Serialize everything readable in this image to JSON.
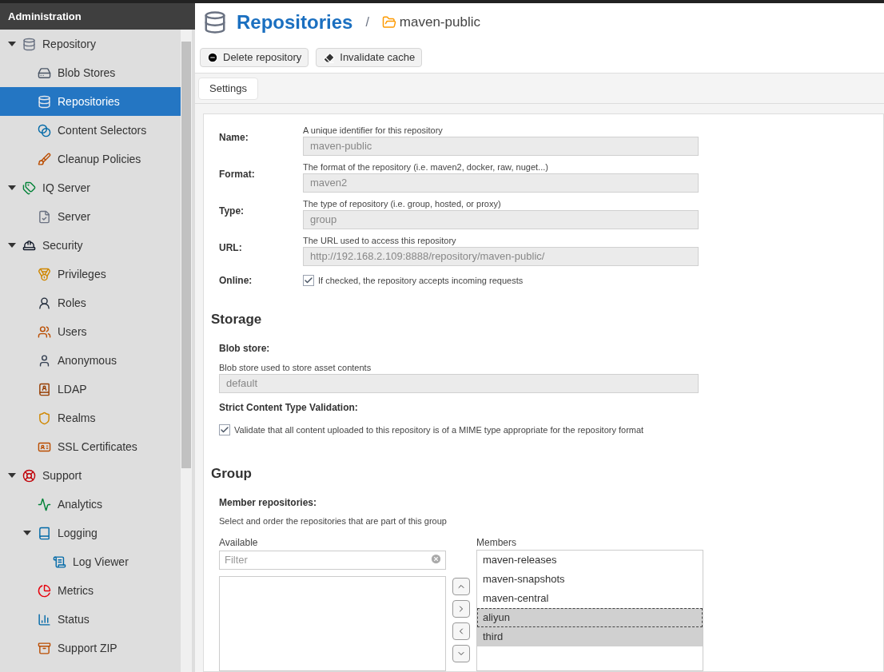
{
  "sidebar": {
    "title": "Administration",
    "items": [
      {
        "label": "Repository",
        "selected": false,
        "expanded": true,
        "children": [
          {
            "label": "Blob Stores",
            "selected": false
          },
          {
            "label": "Repositories",
            "selected": true
          },
          {
            "label": "Content Selectors",
            "selected": false
          },
          {
            "label": "Cleanup Policies",
            "selected": false
          }
        ]
      },
      {
        "label": "IQ Server",
        "selected": false,
        "expanded": true,
        "children": [
          {
            "label": "Server",
            "selected": false
          }
        ]
      },
      {
        "label": "Security",
        "selected": false,
        "expanded": true,
        "children": [
          {
            "label": "Privileges",
            "selected": false
          },
          {
            "label": "Roles",
            "selected": false
          },
          {
            "label": "Users",
            "selected": false
          },
          {
            "label": "Anonymous",
            "selected": false
          },
          {
            "label": "LDAP",
            "selected": false
          },
          {
            "label": "Realms",
            "selected": false
          },
          {
            "label": "SSL Certificates",
            "selected": false
          }
        ]
      },
      {
        "label": "Support",
        "selected": false,
        "expanded": true,
        "children": [
          {
            "label": "Analytics",
            "selected": false
          },
          {
            "label": "Logging",
            "selected": false,
            "expanded": true,
            "children": [
              {
                "label": "Log Viewer",
                "selected": false
              }
            ]
          },
          {
            "label": "Metrics",
            "selected": false
          },
          {
            "label": "Status",
            "selected": false
          },
          {
            "label": "Support ZIP",
            "selected": false
          }
        ]
      }
    ]
  },
  "header": {
    "title": "Repositories",
    "separator": "/",
    "repository": "maven-public"
  },
  "toolbar": {
    "buttons": [
      "Delete repository",
      "Invalidate cache"
    ]
  },
  "tabs": [
    {
      "label": "Settings",
      "selected": true
    }
  ],
  "settings": {
    "fields": [
      {
        "label": "Name:",
        "help": "A unique identifier for this repository",
        "value": "maven-public"
      },
      {
        "label": "Format:",
        "help": "The format of the repository (i.e. maven2, docker, raw, nuget...)",
        "value": "maven2"
      },
      {
        "label": "Type:",
        "help": "The type of repository (i.e. group, hosted, or proxy)",
        "value": "group"
      },
      {
        "label": "URL:",
        "help": "The URL used to access this repository",
        "value": "http://192.168.2.109:8888/repository/maven-public/"
      }
    ],
    "online": {
      "label": "Online:",
      "help": "If checked, the repository accepts incoming requests",
      "checked": true
    }
  },
  "storage": {
    "title": "Storage",
    "blob_store": {
      "label": "Blob store:",
      "help": "Blob store used to store asset contents",
      "value": "default"
    },
    "strict": {
      "label": "Strict Content Type Validation:",
      "help": "Validate that all content uploaded to this repository is of a MIME type appropriate for the repository format",
      "checked": true
    }
  },
  "group": {
    "title": "Group",
    "label": "Member repositories:",
    "help": "Select and order the repositories that are part of this group",
    "available": {
      "label": "Available",
      "placeholder": "Filter"
    },
    "members": {
      "label": "Members",
      "items": [
        {
          "label": "maven-releases",
          "selected": false,
          "focused": false
        },
        {
          "label": "maven-snapshots",
          "selected": false,
          "focused": false
        },
        {
          "label": "maven-central",
          "selected": false,
          "focused": false
        },
        {
          "label": "aliyun",
          "selected": true,
          "focused": true
        },
        {
          "label": "third",
          "selected": true,
          "focused": false
        }
      ]
    }
  }
}
